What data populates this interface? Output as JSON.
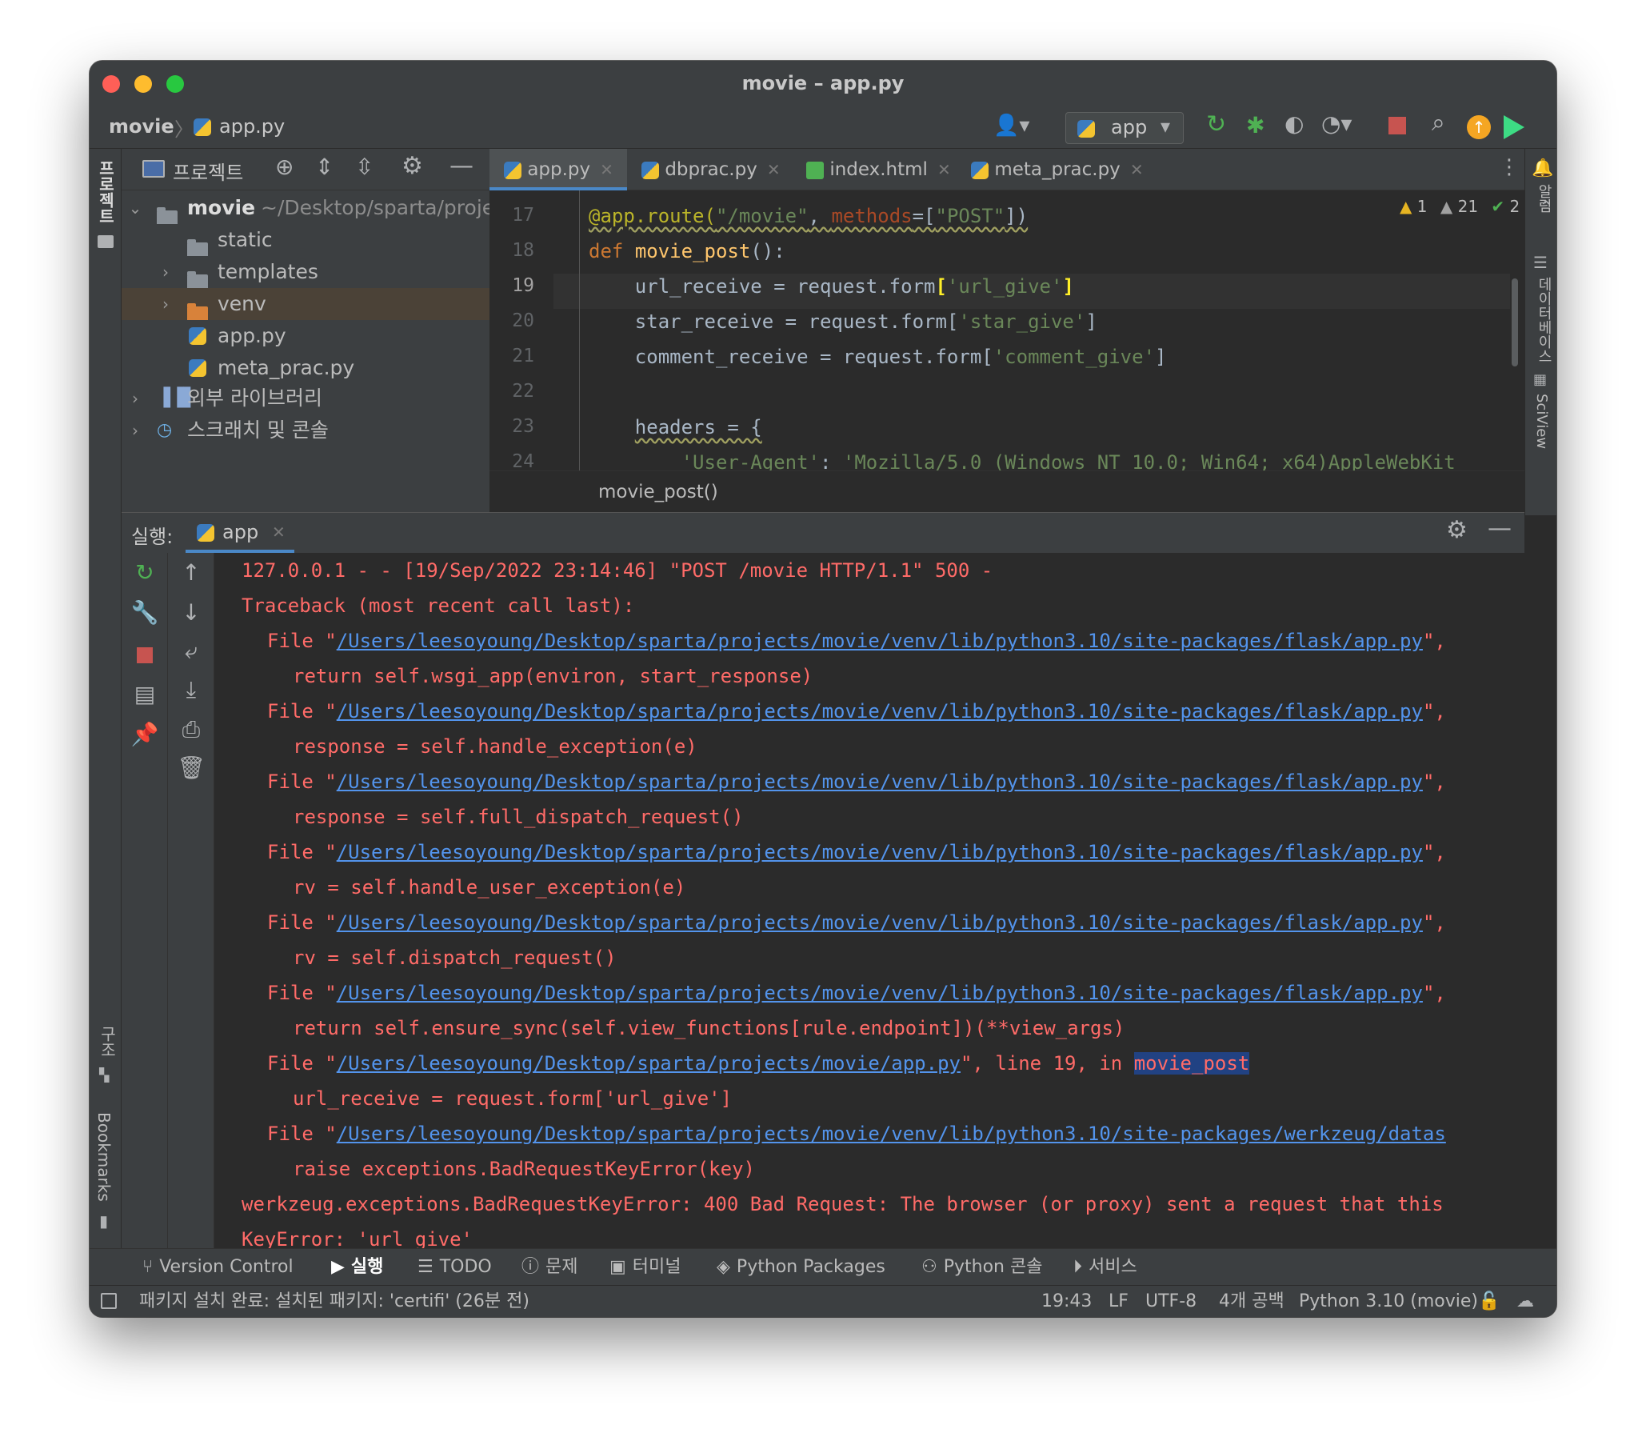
{
  "window": {
    "title": "movie – app.py"
  },
  "navbar": {
    "project": "movie",
    "file": "app.py",
    "run_config": "app"
  },
  "left_strip": {
    "project_tab": "프로젝트",
    "structure_tab": "구조",
    "bookmarks_tab": "Bookmarks"
  },
  "right_strip": {
    "notifications_tab": "알림",
    "database_tab": "데이터베이스",
    "sciview_tab": "SciView"
  },
  "project_panel": {
    "title": "프로젝트",
    "tree": [
      {
        "label": "movie",
        "path": "~/Desktop/sparta/proje"
      },
      {
        "label": "static"
      },
      {
        "label": "templates"
      },
      {
        "label": "venv"
      },
      {
        "label": "app.py"
      },
      {
        "label": "meta_prac.py"
      },
      {
        "label": "외부 라이브러리"
      },
      {
        "label": "스크래치 및 콘솔"
      }
    ]
  },
  "editor": {
    "tabs": [
      {
        "label": "app.py"
      },
      {
        "label": "dbprac.py"
      },
      {
        "label": "index.html"
      },
      {
        "label": "meta_prac.py"
      }
    ],
    "inspections": {
      "warnings": "1",
      "weak_warnings": "21",
      "ok": "2"
    },
    "line_numbers": [
      "17",
      "18",
      "19",
      "20",
      "21",
      "22",
      "23",
      "24"
    ],
    "breadcrumb": "movie_post()"
  },
  "run_panel": {
    "label": "실행:",
    "tab": "app",
    "console": {
      "line1": "127.0.0.1 - - [19/Sep/2022 23:14:46] \"POST /movie HTTP/1.1\" 500 -",
      "traceback": "Traceback (most recent call last):",
      "file_prefix": "File \"",
      "flask_path": "/Users/leesoyoung/Desktop/sparta/projects/movie/venv/lib/python3.10/site-packages/flask/app.py",
      "file_suffix": "\",",
      "c1": "return self.wsgi_app(environ, start_response)",
      "c2": "response = self.handle_exception(e)",
      "c3": "response = self.full_dispatch_request()",
      "c4": "rv = self.handle_user_exception(e)",
      "c5": "rv = self.dispatch_request()",
      "c6": "return self.ensure_sync(self.view_functions[rule.endpoint])(**view_args)",
      "app_path": "/Users/leesoyoung/Desktop/sparta/projects/movie/app.py",
      "app_suffix": "\", line 19, in ",
      "func": "movie_post",
      "c7": "url_receive = request.form['url_give']",
      "werk_path": "/Users/leesoyoung/Desktop/sparta/projects/movie/venv/lib/python3.10/site-packages/werkzeug/datas",
      "c8": "raise exceptions.BadRequestKeyError(key)",
      "err1": "werkzeug.exceptions.BadRequestKeyError: 400 Bad Request: The browser (or proxy) sent a request that this",
      "err2": "KeyError: 'url_give'"
    }
  },
  "bottom_tabs": [
    {
      "label": "Version Control"
    },
    {
      "label": "실행"
    },
    {
      "label": "TODO"
    },
    {
      "label": "문제"
    },
    {
      "label": "터미널"
    },
    {
      "label": "Python Packages"
    },
    {
      "label": "Python 콘솔"
    },
    {
      "label": "서비스"
    }
  ],
  "status_bar": {
    "message": "패키지 설치 완료: 설치된 패키지: 'certifi' (26분 전)",
    "position": "19:43",
    "line_sep": "LF",
    "encoding": "UTF-8",
    "indent": "4개 공백",
    "interpreter": "Python 3.10 (movie)"
  }
}
